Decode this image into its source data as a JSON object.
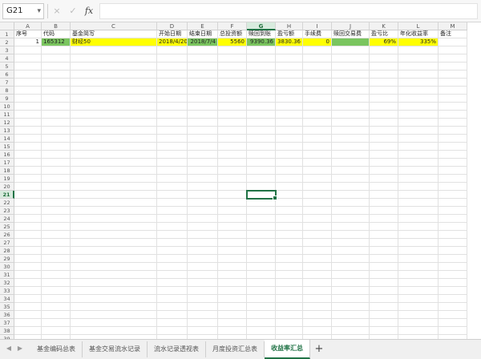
{
  "formula_bar": {
    "name_box": "G21",
    "name_box_caret": "▾",
    "cancel_icon": "×",
    "enter_icon": "✓",
    "function_label": "fx",
    "formula_value": ""
  },
  "columns": [
    "A",
    "B",
    "C",
    "D",
    "E",
    "F",
    "G",
    "H",
    "I",
    "J",
    "K",
    "L",
    "M"
  ],
  "selected_column": "G",
  "selected_row": 21,
  "row_count": 39,
  "rows": [
    [
      "序号",
      "代码",
      "基金简写",
      "开始日期",
      "结束日期",
      "总投资额",
      "赎回到账",
      "盈亏额",
      "手续费",
      "赎回交易费",
      "盈亏比",
      "年化收益率",
      "备注"
    ],
    [
      "1",
      "165312",
      "财经50",
      "2018/4/20",
      "2018/7/4",
      "5560",
      "9390.36",
      "3830.36",
      "0",
      "",
      "69%",
      "335%",
      ""
    ]
  ],
  "sheets": [
    "基金编码总表",
    "基金交易流水记录",
    "流水记录透视表",
    "月度投资汇总表",
    "收益率汇总"
  ],
  "active_sheet": 4,
  "add_sheet_label": "+",
  "nav_prev": "◀",
  "nav_next": "▶",
  "colors": {
    "accent": "#217346",
    "highlight_yellow": "#ffff00",
    "highlight_green": "#7ac55f"
  }
}
